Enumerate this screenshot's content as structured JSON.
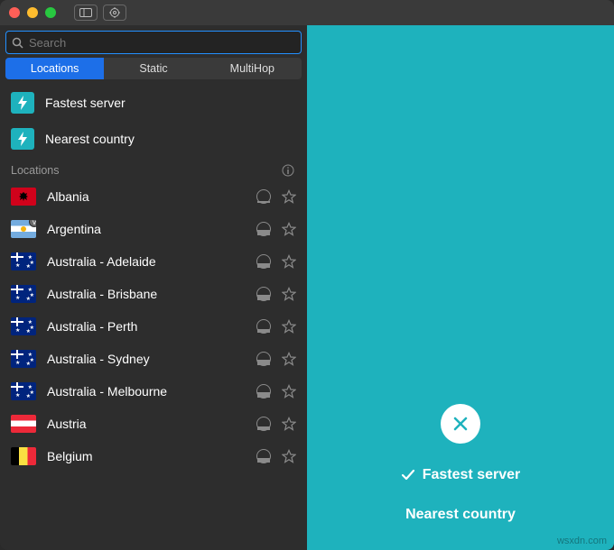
{
  "search": {
    "placeholder": "Search",
    "value": ""
  },
  "tabs": {
    "locations": "Locations",
    "static": "Static",
    "multihop": "MultiHop",
    "active": "locations"
  },
  "quick": {
    "fastest": "Fastest server",
    "nearest": "Nearest country"
  },
  "section": {
    "title": "Locations"
  },
  "locations": [
    {
      "name": "Albania",
      "flag": "al",
      "load": 15,
      "badge": false
    },
    {
      "name": "Argentina",
      "flag": "ar",
      "load": 45,
      "badge": true
    },
    {
      "name": "Australia - Adelaide",
      "flag": "au",
      "load": 35,
      "badge": false
    },
    {
      "name": "Australia - Brisbane",
      "flag": "au",
      "load": 40,
      "badge": false
    },
    {
      "name": "Australia - Perth",
      "flag": "au",
      "load": 30,
      "badge": false
    },
    {
      "name": "Australia - Sydney",
      "flag": "au",
      "load": 45,
      "badge": false
    },
    {
      "name": "Australia - Melbourne",
      "flag": "au",
      "load": 40,
      "badge": false
    },
    {
      "name": "Austria",
      "flag": "at",
      "load": 30,
      "badge": false
    },
    {
      "name": "Belgium",
      "flag": "be",
      "load": 35,
      "badge": false
    }
  ],
  "main": {
    "fastest": "Fastest server",
    "nearest": "Nearest country"
  },
  "watermark": "wsxdn.com",
  "colors": {
    "accent": "#1eb2bd",
    "tab_active": "#1d6fe8",
    "search_border": "#2390ff"
  }
}
